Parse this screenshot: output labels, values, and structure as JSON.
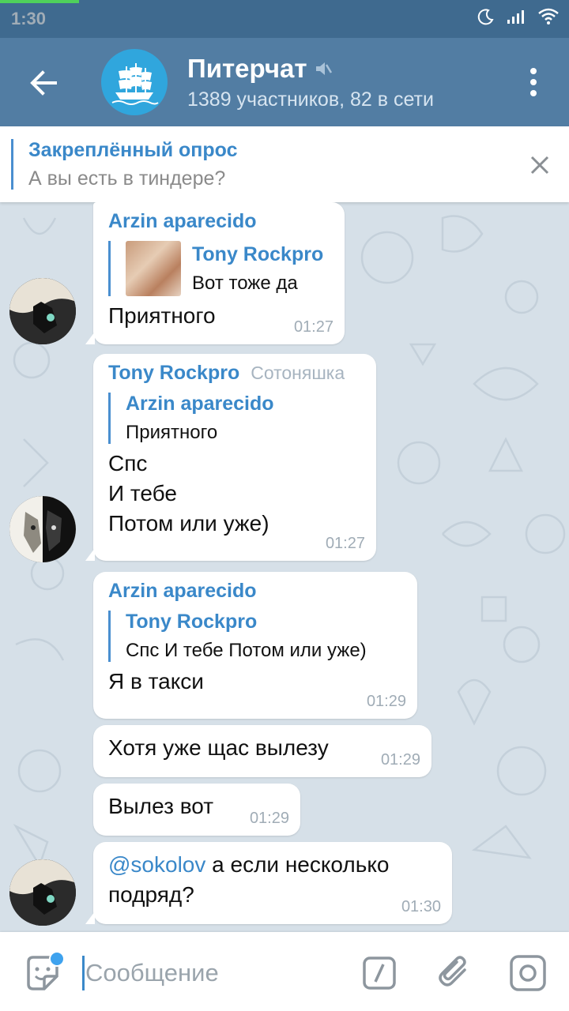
{
  "status": {
    "time": "1:30"
  },
  "header": {
    "title": "Питерчат",
    "subtitle": "1389 участников, 82 в сети"
  },
  "pinned": {
    "title": "Закреплённый опрос",
    "text": "А вы есть в тиндере?"
  },
  "messages": [
    {
      "sender": "Arzin aparecido",
      "reply": {
        "name": "Tony Rockpro",
        "text": "Вот тоже да",
        "has_thumbnail": true
      },
      "text": "Приятного",
      "time": "01:27"
    },
    {
      "sender": "Tony Rockpro",
      "badge": "Сотоняшка",
      "reply": {
        "name": "Arzin aparecido",
        "text": "Приятного"
      },
      "lines": [
        "Спс",
        "И тебе",
        "Потом или уже)"
      ],
      "time": "01:27"
    },
    {
      "sender": "Arzin aparecido",
      "reply": {
        "name": "Tony Rockpro",
        "text": "Спс И тебе Потом или уже)"
      },
      "text": "Я в такси",
      "time": "01:29"
    },
    {
      "text": "Хотя уже щас вылезу",
      "time": "01:29"
    },
    {
      "text": "Вылез вот",
      "time": "01:29"
    },
    {
      "mention": "@sokolov",
      "text": " а если несколько",
      "text2": "подряд?",
      "time": "01:30"
    }
  ],
  "composer": {
    "placeholder": "Сообщение"
  },
  "colors": {
    "header": "#527da3",
    "accent": "#3a88c9",
    "chat_bg": "#d6e0e8"
  }
}
